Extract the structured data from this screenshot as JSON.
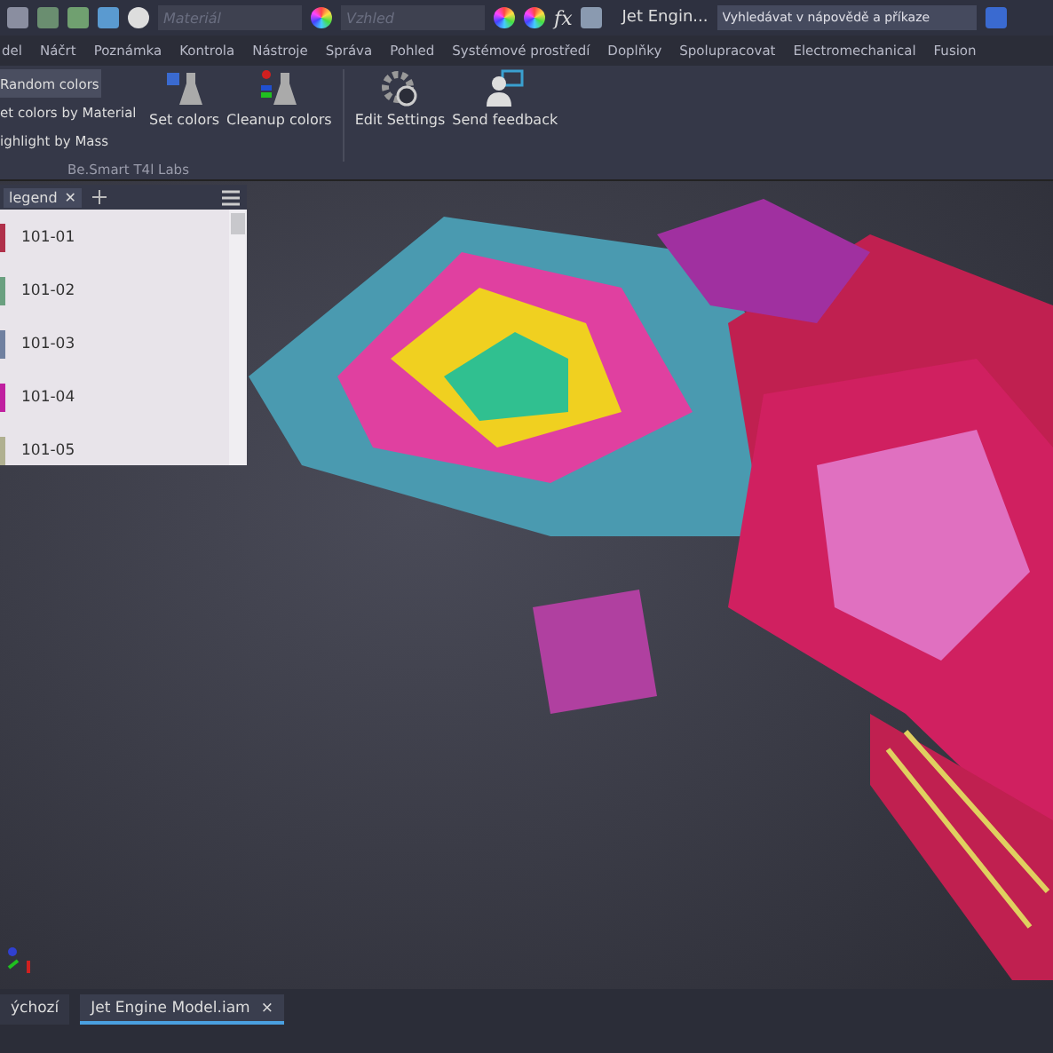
{
  "quick_access": {
    "material_field": {
      "placeholder": "Materiál"
    },
    "appearance_field": {
      "placeholder": "Vzhled"
    },
    "formula": "fx",
    "document_title": "Jet Engin...",
    "search": {
      "placeholder": "Vyhledávat v nápovědě a příkaze"
    }
  },
  "ribbon_tabs": [
    "del",
    "Náčrt",
    "Poznámka",
    "Kontrola",
    "Nástroje",
    "Správa",
    "Pohled",
    "Systémové prostředí",
    "Doplňky",
    "Spolupracovat",
    "Electromechanical",
    "Fusion"
  ],
  "ribbon_panel": {
    "title": "Be.Smart T4l Labs",
    "list_buttons": [
      {
        "label": "Random colors",
        "hovered": true
      },
      {
        "label": "et colors by Material",
        "hovered": false
      },
      {
        "label": "ighlight by Mass",
        "hovered": false
      }
    ],
    "large_buttons": [
      {
        "kind": "set",
        "label": "Set colors"
      },
      {
        "kind": "cleanup",
        "label": "Cleanup colors"
      },
      {
        "kind": "settings",
        "label": "Edit Settings"
      },
      {
        "kind": "feedback",
        "label": "Send feedback"
      }
    ]
  },
  "legend_panel": {
    "tab": "legend",
    "close": "✕",
    "items": [
      {
        "label": "101-01",
        "color": "#b0304a"
      },
      {
        "label": "101-02",
        "color": "#6aa080"
      },
      {
        "label": "101-03",
        "color": "#7080a0"
      },
      {
        "label": "101-04",
        "color": "#c020a0"
      },
      {
        "label": "101-05",
        "color": "#b0b090"
      }
    ]
  },
  "document_tabs": [
    {
      "label": "ýchozí",
      "selected": false
    },
    {
      "label": "Jet Engine Model.iam",
      "selected": true,
      "close": "×"
    }
  ]
}
